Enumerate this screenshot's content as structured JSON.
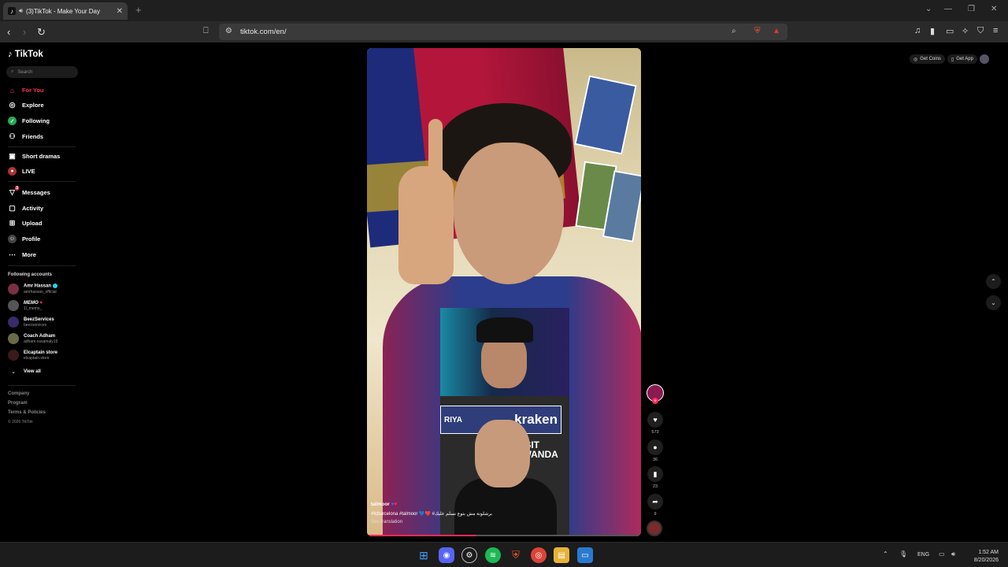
{
  "browser": {
    "tab_title": "(3)TikTok - Make Your Day",
    "url": "tiktok.com/en/",
    "colors": {
      "accent": "#fe2c55",
      "chrome_bg": "#1f1f1f"
    }
  },
  "sidebar": {
    "logo": "TikTok",
    "search_placeholder": "Search",
    "nav": [
      {
        "label": "For You",
        "icon": "home-icon",
        "active": true
      },
      {
        "label": "Explore",
        "icon": "compass-icon"
      },
      {
        "label": "Following",
        "icon": "following-icon"
      },
      {
        "label": "Friends",
        "icon": "friends-icon"
      },
      {
        "label": "Short dramas",
        "icon": "film-icon"
      },
      {
        "label": "LIVE",
        "icon": "live-icon"
      },
      {
        "label": "Messages",
        "icon": "messages-icon",
        "badge": "3"
      },
      {
        "label": "Activity",
        "icon": "activity-icon"
      },
      {
        "label": "Upload",
        "icon": "upload-icon"
      },
      {
        "label": "Profile",
        "icon": "profile-icon"
      },
      {
        "label": "More",
        "icon": "more-icon"
      }
    ],
    "following_title": "Following accounts",
    "accounts": [
      {
        "name": "Amr Hassan",
        "handle": "amrhassan_official"
      },
      {
        "name": "MEMO",
        "handle": "1l_memo_"
      },
      {
        "name": "BeezServices",
        "handle": "beezservices"
      },
      {
        "name": "Coach Adham",
        "handle": "adham.ossamaly15"
      },
      {
        "name": "Elcaptain store",
        "handle": "elcaptain.store"
      }
    ],
    "view_all": "View all",
    "footer": [
      "Company",
      "Program",
      "Terms & Policies"
    ],
    "copyright": "© 2026 TikTok"
  },
  "topright": {
    "coins": "Get Coins",
    "app": "Get App"
  },
  "video": {
    "username": "talmoor",
    "caption": "#fcbarcelona #talmoor 💙❤️ #برشلونة مش بتوع نسلم عليك",
    "see_translation": "See translation",
    "sponsor": "kraken",
    "sponsor_left": "RIYA",
    "banner": "VISIT RWANDA",
    "progress": 0.4
  },
  "actions": {
    "likes": "573",
    "comments": "36",
    "saves": "23",
    "shares": "9"
  },
  "taskbar": {
    "lang": "ENG",
    "time": "1:52 AM",
    "date": "8/20/2026"
  }
}
